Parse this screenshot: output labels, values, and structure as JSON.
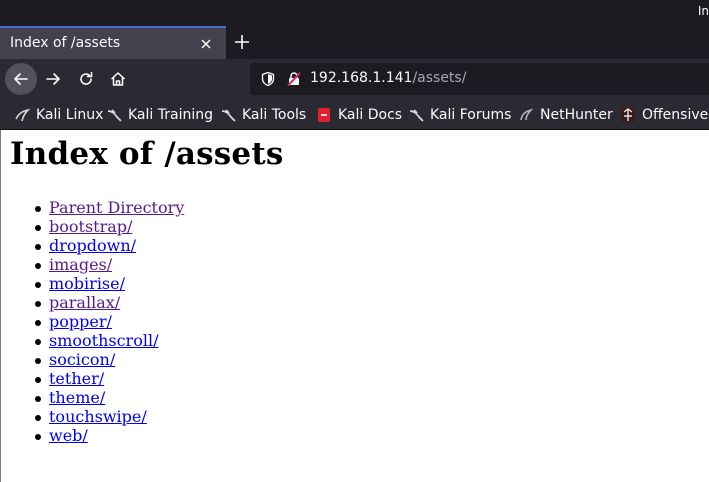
{
  "window": {
    "title_fragment": "In"
  },
  "tab": {
    "title": "Index of /assets"
  },
  "toolbar": {
    "url_host": "192.168.1.141",
    "url_path": "/assets/"
  },
  "bookmarks": [
    {
      "label": "Kali Linux",
      "icon": "kali-dragon-icon"
    },
    {
      "label": "Kali Training",
      "icon": "kali-dragon-icon"
    },
    {
      "label": "Kali Tools",
      "icon": "kali-dragon-icon"
    },
    {
      "label": "Kali Docs",
      "icon": "kali-docs-icon"
    },
    {
      "label": "Kali Forums",
      "icon": "kali-dragon-icon"
    },
    {
      "label": "NetHunter",
      "icon": "nethunter-icon"
    },
    {
      "label": "Offensive",
      "icon": "offsec-icon"
    }
  ],
  "page": {
    "heading": "Index of /assets",
    "entries": [
      {
        "label": "Parent Directory",
        "visited": true
      },
      {
        "label": "bootstrap/",
        "visited": true
      },
      {
        "label": "dropdown/",
        "visited": false
      },
      {
        "label": "images/",
        "visited": true
      },
      {
        "label": "mobirise/",
        "visited": false
      },
      {
        "label": "parallax/",
        "visited": true
      },
      {
        "label": "popper/",
        "visited": false
      },
      {
        "label": "smoothscroll/",
        "visited": false
      },
      {
        "label": "socicon/",
        "visited": false
      },
      {
        "label": "tether/",
        "visited": false
      },
      {
        "label": "theme/",
        "visited": false
      },
      {
        "label": "touchswipe/",
        "visited": false
      },
      {
        "label": "web/",
        "visited": false
      }
    ]
  },
  "colors": {
    "link": "#0000ee",
    "visited_link": "#551a8b",
    "chrome_dark": "#1c1b22",
    "chrome": "#2b2a33",
    "active_tab": "#42414d"
  }
}
